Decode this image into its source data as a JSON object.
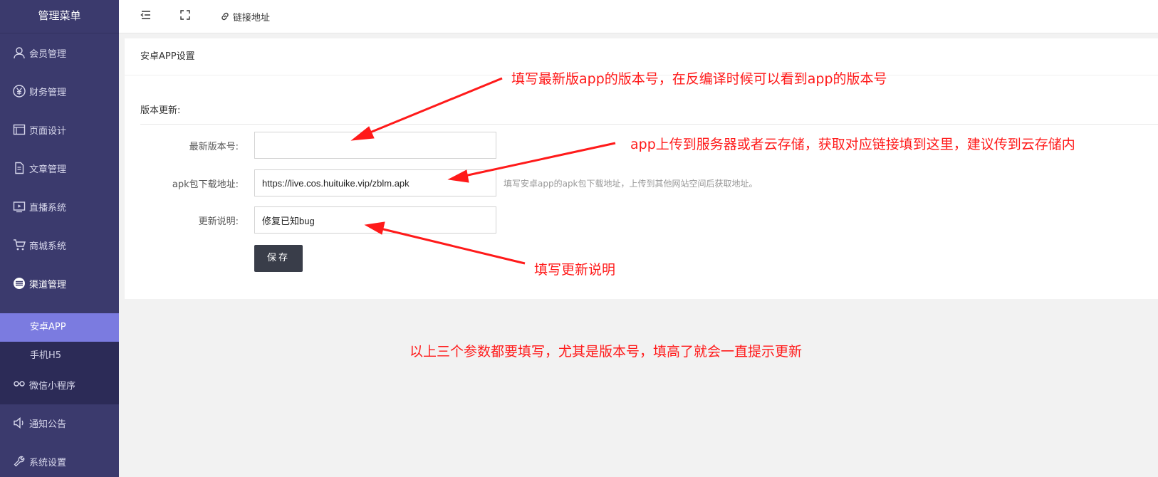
{
  "sidebar": {
    "title": "管理菜单",
    "items": [
      {
        "label": "会员管理",
        "icon": "user-icon"
      },
      {
        "label": "财务管理",
        "icon": "yen-icon"
      },
      {
        "label": "页面设计",
        "icon": "layout-icon"
      },
      {
        "label": "文章管理",
        "icon": "document-icon"
      },
      {
        "label": "直播系统",
        "icon": "video-icon"
      },
      {
        "label": "商城系统",
        "icon": "cart-icon"
      },
      {
        "label": "渠道管理",
        "icon": "channel-icon"
      },
      {
        "label": "微信小程序",
        "icon": "wechat-icon"
      },
      {
        "label": "通知公告",
        "icon": "speaker-icon"
      },
      {
        "label": "系统设置",
        "icon": "wrench-icon"
      }
    ],
    "subitems": [
      {
        "label": "安卓APP"
      },
      {
        "label": "手机H5"
      }
    ]
  },
  "topbar": {
    "link_label": "链接地址"
  },
  "card": {
    "title": "安卓APP设置",
    "section_title": "版本更新:",
    "fields": {
      "version": {
        "label": "最新版本号:",
        "value": ""
      },
      "apk": {
        "label": "apk包下载地址:",
        "value": "https://live.cos.huituike.vip/zblm.apk",
        "hint": "填写安卓app的apk包下载地址，上传到其他网站空间后获取地址。"
      },
      "notes": {
        "label": "更新说明:",
        "value": "修复已知bug"
      }
    },
    "save_label": "保存"
  },
  "annotations": {
    "a1": "填写最新版app的版本号，在反编译时候可以看到app的版本号",
    "a2": "app上传到服务器或者云存储，获取对应链接填到这里，建议传到云存储内",
    "a3": "填写更新说明",
    "a4": "以上三个参数都要填写，尤其是版本号，填高了就会一直提示更新"
  },
  "colors": {
    "sidebar_bg": "#3b3a6d",
    "sub_bg": "#2c2b57",
    "active": "#7b7be0",
    "annotation": "#ff1a1a",
    "button": "#393d49"
  }
}
